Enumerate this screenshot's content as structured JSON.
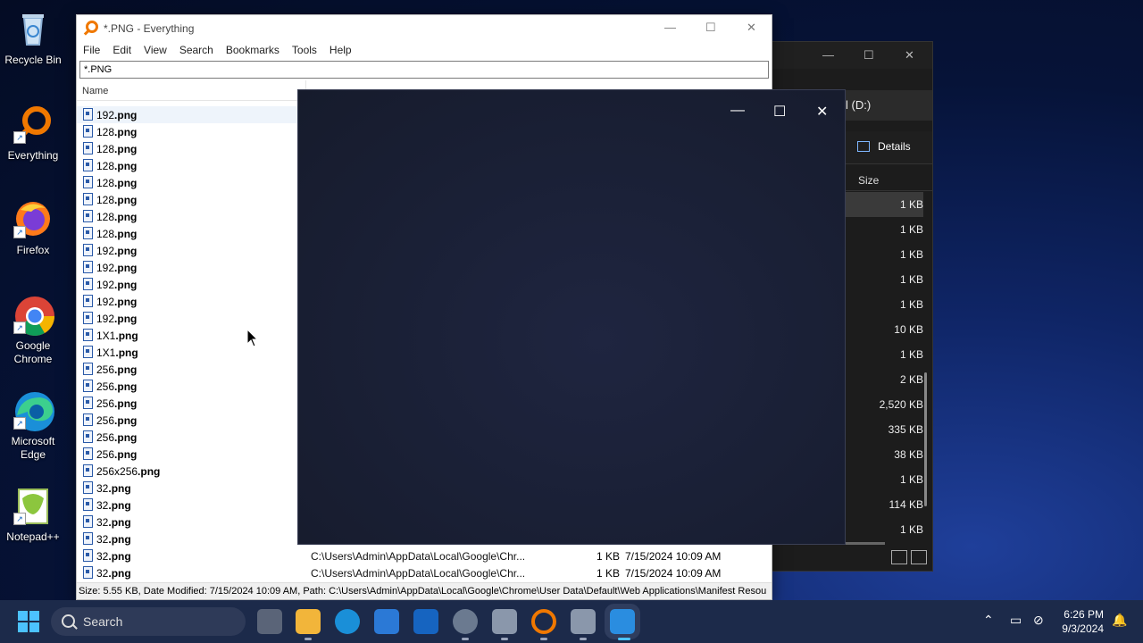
{
  "desktop": {
    "icons": [
      {
        "label": "Recycle Bin"
      },
      {
        "label": "Everything"
      },
      {
        "label": "Firefox"
      },
      {
        "label": "Google Chrome"
      },
      {
        "label": "Microsoft Edge"
      },
      {
        "label": "Notepad++"
      }
    ]
  },
  "everything": {
    "title": "*.PNG - Everything",
    "menu": [
      "File",
      "Edit",
      "View",
      "Search",
      "Bookmarks",
      "Tools",
      "Help"
    ],
    "search_value": "*.PNG",
    "column_name": "Name",
    "rows": [
      {
        "base": "192",
        "ext": ".png"
      },
      {
        "base": "128",
        "ext": ".png"
      },
      {
        "base": "128",
        "ext": ".png"
      },
      {
        "base": "128",
        "ext": ".png"
      },
      {
        "base": "128",
        "ext": ".png"
      },
      {
        "base": "128",
        "ext": ".png"
      },
      {
        "base": "128",
        "ext": ".png"
      },
      {
        "base": "128",
        "ext": ".png"
      },
      {
        "base": "192",
        "ext": ".png"
      },
      {
        "base": "192",
        "ext": ".png"
      },
      {
        "base": "192",
        "ext": ".png"
      },
      {
        "base": "192",
        "ext": ".png"
      },
      {
        "base": "192",
        "ext": ".png"
      },
      {
        "base": "1X1",
        "ext": ".png"
      },
      {
        "base": "1X1",
        "ext": ".png"
      },
      {
        "base": "256",
        "ext": ".png"
      },
      {
        "base": "256",
        "ext": ".png"
      },
      {
        "base": "256",
        "ext": ".png"
      },
      {
        "base": "256",
        "ext": ".png"
      },
      {
        "base": "256",
        "ext": ".png"
      },
      {
        "base": "256",
        "ext": ".png"
      },
      {
        "base": "256x256",
        "ext": ".png"
      },
      {
        "base": "32",
        "ext": ".png"
      },
      {
        "base": "32",
        "ext": ".png"
      },
      {
        "base": "32",
        "ext": ".png"
      },
      {
        "base": "32",
        "ext": ".png"
      },
      {
        "base": "32",
        "ext": ".png",
        "path": "C:\\Users\\Admin\\AppData\\Local\\Google\\Chr...",
        "size": "1 KB",
        "date": "7/15/2024 10:09 AM"
      },
      {
        "base": "32",
        "ext": ".png",
        "path": "C:\\Users\\Admin\\AppData\\Local\\Google\\Chr...",
        "size": "1 KB",
        "date": "7/15/2024 10:09 AM"
      }
    ],
    "status": "Size: 5.55 KB, Date Modified: 7/15/2024 10:09 AM, Path: C:\\Users\\Admin\\AppData\\Local\\Google\\Chrome\\User Data\\Default\\Web Applications\\Manifest Resou"
  },
  "explorer": {
    "address_partial": "l (D:)",
    "details_label": "Details",
    "size_header": "Size",
    "sizes": [
      "1 KB",
      "1 KB",
      "1 KB",
      "1 KB",
      "1 KB",
      "10 KB",
      "1 KB",
      "2 KB",
      "2,520 KB",
      "335 KB",
      "38 KB",
      "1 KB",
      "114 KB",
      "1 KB"
    ]
  },
  "taskbar": {
    "search_label": "Search",
    "time": "6:26 PM",
    "date": "9/3/2024"
  },
  "colors": {
    "accent_orange": "#f07800",
    "taskbar_bg": "#1c2a4a",
    "dark_window_bg": "#1a2036"
  }
}
